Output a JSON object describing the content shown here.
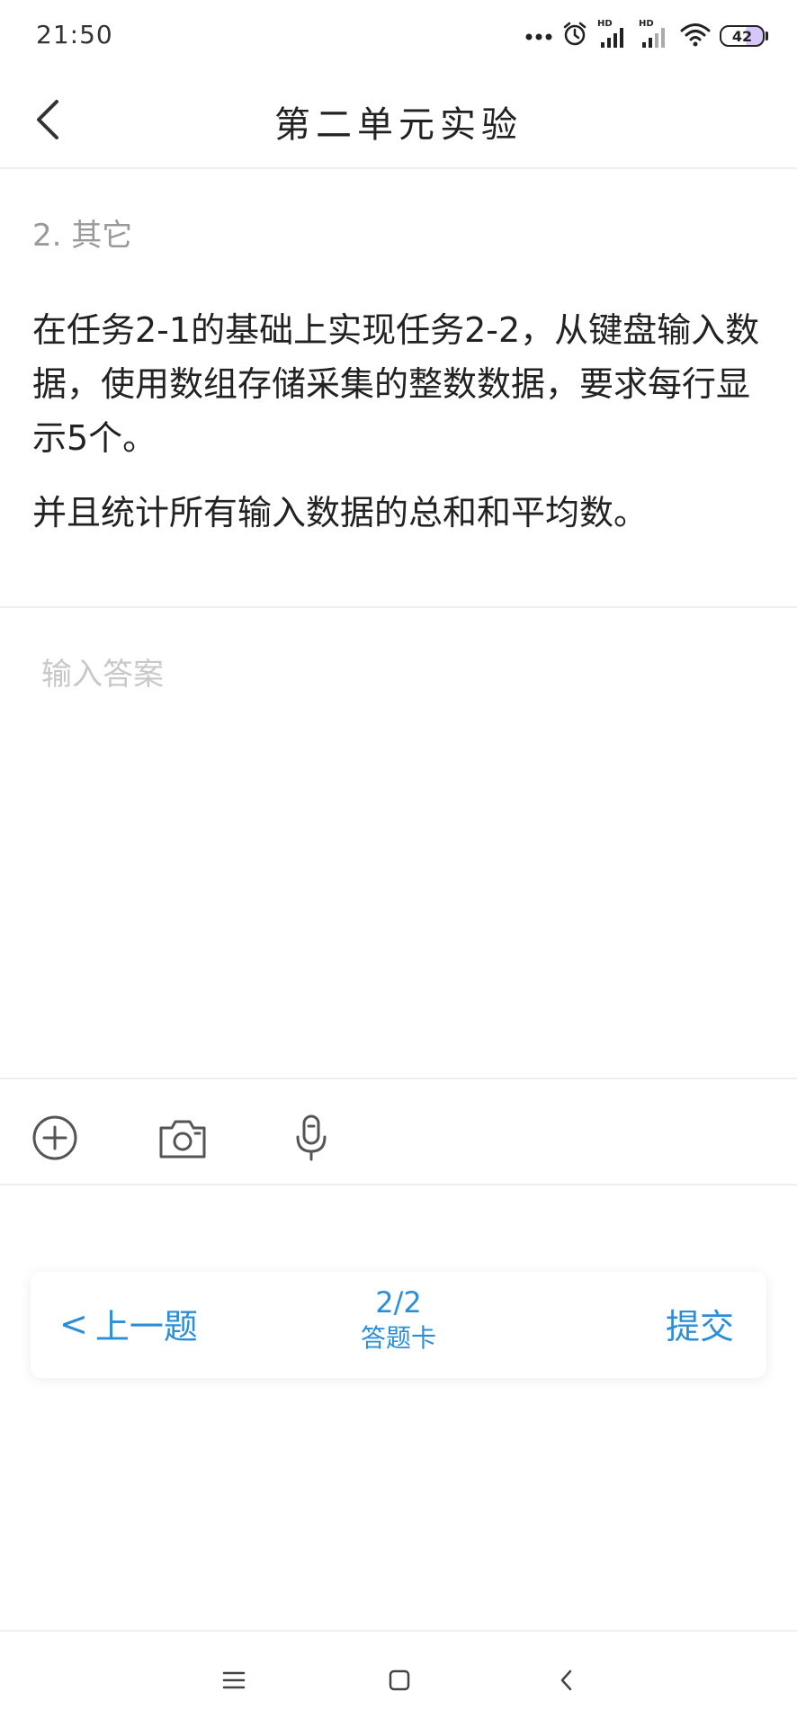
{
  "status_bar": {
    "time": "21:50",
    "battery": "42",
    "icons": [
      "more-dots-icon",
      "alarm-icon",
      "hd-signal-icon",
      "hd-signal-icon",
      "wifi-icon",
      "battery-icon"
    ],
    "hd_label": "HD"
  },
  "header": {
    "title": "第二单元实验",
    "back_icon": "chevron-left-icon"
  },
  "question": {
    "label": "2. 其它",
    "paragraph1": "在任务2-1的基础上实现任务2-2，从键盘输入数据，使用数组存储采集的整数数据，要求每行显示5个。",
    "paragraph2": "并且统计所有输入数据的总和和平均数。"
  },
  "answer": {
    "placeholder": "输入答案",
    "value": ""
  },
  "toolbar": {
    "icons": [
      "add-circle-icon",
      "camera-icon",
      "microphone-icon"
    ]
  },
  "navigation": {
    "prev_chevron": "<",
    "prev_label": "上一题",
    "progress": "2/2",
    "answer_card_label": "答题卡",
    "submit_label": "提交"
  },
  "system_nav": {
    "icons": [
      "menu-icon",
      "home-square-icon",
      "back-icon"
    ]
  },
  "colors": {
    "accent": "#2b8ed8",
    "text": "#222222",
    "muted": "#9a9a9a",
    "placeholder": "#c8c8c8",
    "divider": "#eeeeee"
  }
}
